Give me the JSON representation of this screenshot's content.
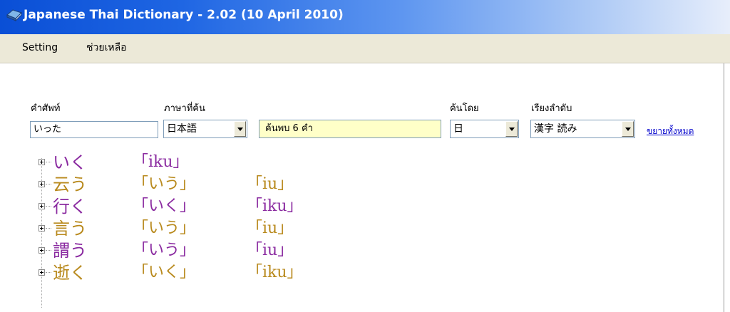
{
  "window": {
    "title": "Japanese Thai Dictionary - 2.02 (10 April 2010)",
    "icon": "book-icon"
  },
  "menu": {
    "items": [
      {
        "label": "Setting"
      },
      {
        "label": "ช่วยเหลือ"
      }
    ]
  },
  "search": {
    "word_label": "คำศัพท์",
    "word_value": "いった",
    "language_label": "ภาษาที่ค้น",
    "language_value": "日本語",
    "result_status": "ค้นพบ 6 คำ",
    "search_by_label": "ค้นโดย",
    "search_by_value": "日",
    "sort_label": "เรียงลำดับ",
    "sort_value": "漢字 読み",
    "expand_all_link": "ขยายทั้งหมด"
  },
  "results": {
    "colors": {
      "purple": "#8a2aa0",
      "gold": "#b8891c"
    },
    "items": [
      {
        "word": "いく",
        "reading": "「iku」",
        "romaji": "",
        "color": "#8a2aa0"
      },
      {
        "word": "云う",
        "reading": "「いう」",
        "romaji": "「iu」",
        "color": "#b8891c"
      },
      {
        "word": "行く",
        "reading": "「いく」",
        "romaji": "「iku」",
        "color": "#8a2aa0"
      },
      {
        "word": "言う",
        "reading": "「いう」",
        "romaji": "「iu」",
        "color": "#b8891c"
      },
      {
        "word": "謂う",
        "reading": "「いう」",
        "romaji": "「iu」",
        "color": "#8a2aa0"
      },
      {
        "word": "逝く",
        "reading": "「いく」",
        "romaji": "「iku」",
        "color": "#b8891c"
      }
    ]
  }
}
